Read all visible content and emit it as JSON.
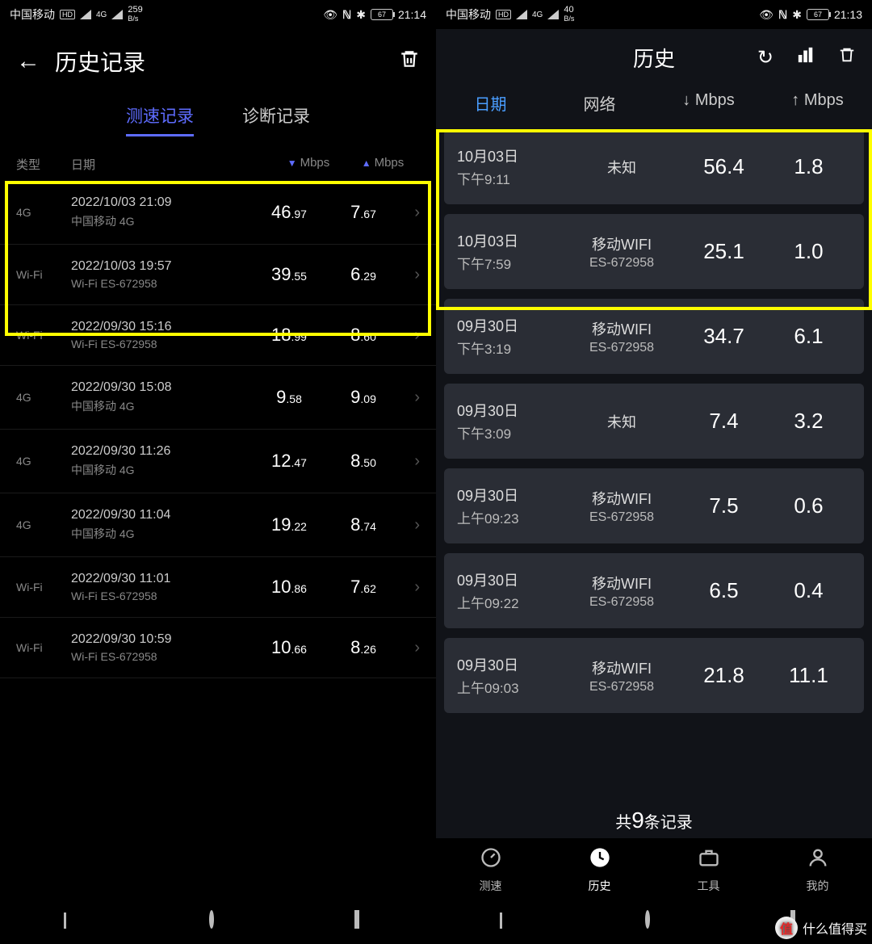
{
  "left": {
    "statusbar": {
      "carrier": "中国移动",
      "hd": "HD",
      "net_small": "4G",
      "speed_val": "259",
      "speed_unit": "B/s",
      "battery": "67",
      "time": "21:14"
    },
    "header": {
      "title": "历史记录"
    },
    "tabs": {
      "speed": "测速记录",
      "diag": "诊断记录"
    },
    "thead": {
      "type": "类型",
      "date": "日期",
      "down": "Mbps",
      "up": "Mbps"
    },
    "rows": [
      {
        "type": "4G",
        "date": "2022/10/03 21:09",
        "net": "中国移动 4G",
        "dn_int": "46",
        "dn_dec": ".97",
        "up_int": "7",
        "up_dec": ".67"
      },
      {
        "type": "Wi-Fi",
        "date": "2022/10/03 19:57",
        "net": "Wi-Fi ES-672958",
        "dn_int": "39",
        "dn_dec": ".55",
        "up_int": "6",
        "up_dec": ".29"
      },
      {
        "type": "Wi-Fi",
        "date": "2022/09/30 15:16",
        "net": "Wi-Fi ES-672958",
        "dn_int": "18",
        "dn_dec": ".99",
        "up_int": "8",
        "up_dec": ".60"
      },
      {
        "type": "4G",
        "date": "2022/09/30 15:08",
        "net": "中国移动 4G",
        "dn_int": "9",
        "dn_dec": ".58",
        "up_int": "9",
        "up_dec": ".09"
      },
      {
        "type": "4G",
        "date": "2022/09/30 11:26",
        "net": "中国移动 4G",
        "dn_int": "12",
        "dn_dec": ".47",
        "up_int": "8",
        "up_dec": ".50"
      },
      {
        "type": "4G",
        "date": "2022/09/30 11:04",
        "net": "中国移动 4G",
        "dn_int": "19",
        "dn_dec": ".22",
        "up_int": "8",
        "up_dec": ".74"
      },
      {
        "type": "Wi-Fi",
        "date": "2022/09/30 11:01",
        "net": "Wi-Fi ES-672958",
        "dn_int": "10",
        "dn_dec": ".86",
        "up_int": "7",
        "up_dec": ".62"
      },
      {
        "type": "Wi-Fi",
        "date": "2022/09/30 10:59",
        "net": "Wi-Fi ES-672958",
        "dn_int": "10",
        "dn_dec": ".66",
        "up_int": "8",
        "up_dec": ".26"
      }
    ]
  },
  "right": {
    "statusbar": {
      "carrier": "中国移动",
      "hd": "HD",
      "net_small": "4G",
      "speed_val": "40",
      "speed_unit": "B/s",
      "battery": "67",
      "time": "21:13"
    },
    "header": {
      "title": "历史"
    },
    "tabs": {
      "date": "日期",
      "net": "网络",
      "down": "↓ Mbps",
      "up": "↑ Mbps"
    },
    "rows": [
      {
        "d1": "10月03日",
        "d2": "下午9:11",
        "net1": "未知",
        "net2": "",
        "dn": "56.4",
        "up": "1.8"
      },
      {
        "d1": "10月03日",
        "d2": "下午7:59",
        "net1": "移动WIFI",
        "net2": "ES-672958",
        "dn": "25.1",
        "up": "1.0"
      },
      {
        "d1": "09月30日",
        "d2": "下午3:19",
        "net1": "移动WIFI",
        "net2": "ES-672958",
        "dn": "34.7",
        "up": "6.1"
      },
      {
        "d1": "09月30日",
        "d2": "下午3:09",
        "net1": "未知",
        "net2": "",
        "dn": "7.4",
        "up": "3.2"
      },
      {
        "d1": "09月30日",
        "d2": "上午09:23",
        "net1": "移动WIFI",
        "net2": "ES-672958",
        "dn": "7.5",
        "up": "0.6"
      },
      {
        "d1": "09月30日",
        "d2": "上午09:22",
        "net1": "移动WIFI",
        "net2": "ES-672958",
        "dn": "6.5",
        "up": "0.4"
      },
      {
        "d1": "09月30日",
        "d2": "上午09:03",
        "net1": "移动WIFI",
        "net2": "ES-672958",
        "dn": "21.8",
        "up": "11.1"
      }
    ],
    "summary": {
      "prefix": "共",
      "count": "9",
      "suffix": "条记录"
    },
    "bottomnav": {
      "speed": "测速",
      "history": "历史",
      "tool": "工具",
      "mine": "我的"
    }
  },
  "watermark": {
    "text": "什么值得买",
    "logo": "值"
  }
}
